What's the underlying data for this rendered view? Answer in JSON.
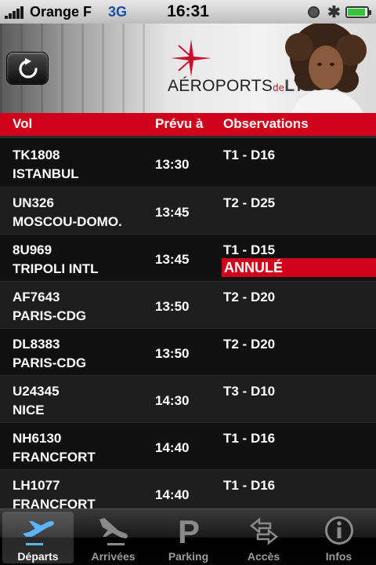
{
  "status_bar": {
    "carrier": "Orange F",
    "network": "3G",
    "time": "16:31",
    "battery_level": 0.9
  },
  "header": {
    "logo_text": {
      "prefix": "AÉROPORTS",
      "de": "de",
      "city": "LYON"
    },
    "icons": {
      "refresh": "refresh-icon",
      "logo": "logo-star-icon"
    }
  },
  "table": {
    "columns": {
      "flight": "Vol",
      "scheduled": "Prévu à",
      "observations": "Observations"
    },
    "rows": [
      {
        "flight": "TK1808",
        "destination": "ISTANBUL",
        "time": "13:30",
        "observation": "T1 - D16",
        "status": ""
      },
      {
        "flight": "UN326",
        "destination": "MOSCOU-DOMO.",
        "time": "13:45",
        "observation": "T2 - D25",
        "status": ""
      },
      {
        "flight": "8U969",
        "destination": "TRIPOLI INTL",
        "time": "13:45",
        "observation": "T1 - D15",
        "status": "ANNULÉ"
      },
      {
        "flight": "AF7643",
        "destination": "PARIS-CDG",
        "time": "13:50",
        "observation": "T2 - D20",
        "status": ""
      },
      {
        "flight": "DL8383",
        "destination": "PARIS-CDG",
        "time": "13:50",
        "observation": "T2 - D20",
        "status": ""
      },
      {
        "flight": "U24345",
        "destination": "NICE",
        "time": "14:30",
        "observation": "T3 - D10",
        "status": ""
      },
      {
        "flight": "NH6130",
        "destination": "FRANCFORT",
        "time": "14:40",
        "observation": "T1 - D16",
        "status": ""
      },
      {
        "flight": "LH1077",
        "destination": "FRANCFORT",
        "time": "14:40",
        "observation": "T1 - D16",
        "status": ""
      }
    ]
  },
  "tabbar": {
    "tabs": [
      {
        "label": "Départs",
        "icon": "departures-icon",
        "active": true
      },
      {
        "label": "Arrivées",
        "icon": "arrivals-icon",
        "active": false
      },
      {
        "label": "Parking",
        "icon": "parking-icon",
        "active": false
      },
      {
        "label": "Accès",
        "icon": "access-arrows-icon",
        "active": false
      },
      {
        "label": "Infos",
        "icon": "info-icon",
        "active": false
      }
    ]
  },
  "colors": {
    "accent": "#d0021b",
    "row_dark": "#111111",
    "row_light": "#1e1e1e"
  }
}
